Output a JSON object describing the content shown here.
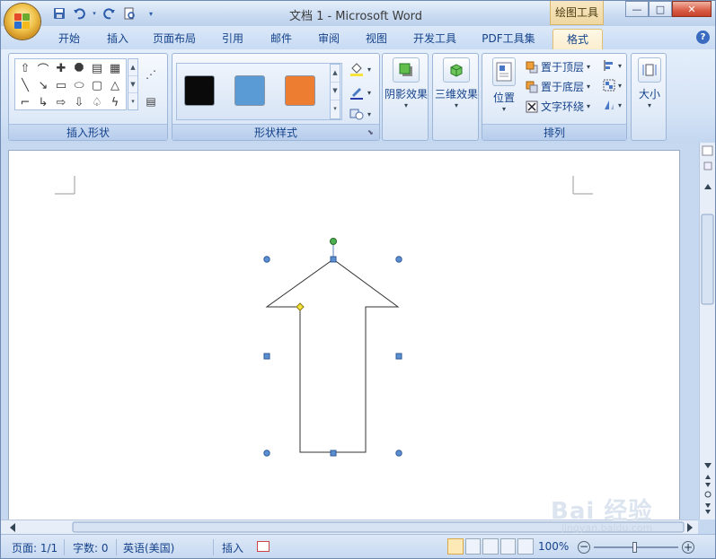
{
  "title_bar": {
    "title": "文档 1 - Microsoft Word",
    "contextual_tab": "绘图工具",
    "minimize": "—",
    "maximize": "□",
    "close": "✕"
  },
  "tabs": [
    {
      "label": "开始"
    },
    {
      "label": "插入"
    },
    {
      "label": "页面布局"
    },
    {
      "label": "引用"
    },
    {
      "label": "邮件"
    },
    {
      "label": "审阅"
    },
    {
      "label": "视图"
    },
    {
      "label": "开发工具"
    },
    {
      "label": "PDF工具集"
    },
    {
      "label": "格式",
      "active": true
    }
  ],
  "help_label": "?",
  "ribbon": {
    "insert_shapes": {
      "label": "插入形状"
    },
    "shape_styles": {
      "label": "形状样式",
      "swatches": [
        "#0a0a0a",
        "#5b9bd5",
        "#ed7d31"
      ]
    },
    "shadow_effects": {
      "label": "阴影效果"
    },
    "three_d_effects": {
      "label": "三维效果"
    },
    "arrange": {
      "label": "排列",
      "position": "位置",
      "bring_to_front": "置于顶层",
      "send_to_back": "置于底层",
      "text_wrap": "文字环绕"
    },
    "size": {
      "label": "大小"
    }
  },
  "status_bar": {
    "page": "页面: 1/1",
    "words": "字数: 0",
    "language": "英语(美国)",
    "mode": "插入",
    "zoom": "100%"
  },
  "watermark": {
    "text": "Bai 经验",
    "sub": "jingyan.baidu.com"
  },
  "colors": {
    "handle_blue": "#5b8fd0",
    "rotation_handle": "#4caf50",
    "adjust_handle": "#f5e23b"
  }
}
